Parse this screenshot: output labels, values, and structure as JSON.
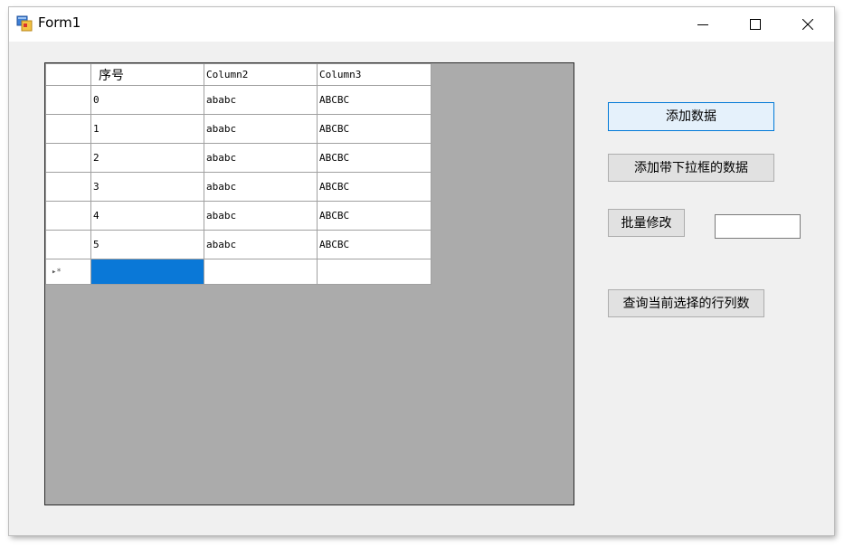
{
  "window": {
    "title": "Form1"
  },
  "grid": {
    "columns": [
      "序号",
      "Column2",
      "Column3"
    ],
    "rows": [
      [
        "0",
        "ababc",
        "ABCBC"
      ],
      [
        "1",
        "ababc",
        "ABCBC"
      ],
      [
        "2",
        "ababc",
        "ABCBC"
      ],
      [
        "3",
        "ababc",
        "ABCBC"
      ],
      [
        "4",
        "ababc",
        "ABCBC"
      ],
      [
        "5",
        "ababc",
        "ABCBC"
      ]
    ],
    "new_row_marker": "▸*"
  },
  "buttons": {
    "add_data": "添加数据",
    "add_dropdown_data": "添加带下拉框的数据",
    "batch_modify": "批量修改",
    "query_selection": "查询当前选择的行列数"
  },
  "batch_input": {
    "value": ""
  },
  "icons": {
    "app": "form-app-icon",
    "minimize": "minimize-icon",
    "maximize": "maximize-icon",
    "close": "close-icon"
  },
  "colors": {
    "selection": "#0a78d7",
    "grid_background": "#ababab",
    "window_background": "#f0f0f0"
  }
}
